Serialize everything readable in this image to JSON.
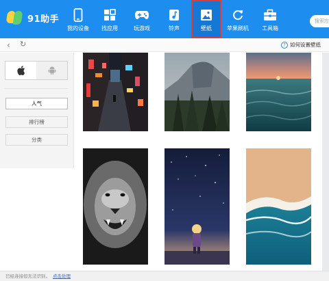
{
  "app": {
    "name": "91助手"
  },
  "nav": {
    "items": [
      {
        "label": "我的设备",
        "icon": "phone-icon"
      },
      {
        "label": "找应用",
        "icon": "apps-grid-icon"
      },
      {
        "label": "玩游戏",
        "icon": "gamepad-icon"
      },
      {
        "label": "铃声",
        "icon": "music-note-icon"
      },
      {
        "label": "壁纸",
        "icon": "image-icon",
        "active": true
      },
      {
        "label": "苹果刷机",
        "icon": "refresh-icon"
      },
      {
        "label": "工具箱",
        "icon": "toolbox-icon"
      }
    ],
    "search_placeholder": "搜索应"
  },
  "toolbar": {
    "back_icon": "chevron-left-icon",
    "refresh_icon": "refresh-icon",
    "help_text": "如何设置壁纸"
  },
  "sidebar": {
    "os": [
      {
        "icon": "apple-icon",
        "selected": true
      },
      {
        "icon": "android-icon",
        "selected": false
      }
    ],
    "categories": [
      {
        "label": "人气",
        "active": true
      },
      {
        "label": "排行榜"
      },
      {
        "label": "分类"
      }
    ]
  },
  "wallpapers": [
    {
      "name": "neon-alley"
    },
    {
      "name": "half-dome-mountain"
    },
    {
      "name": "ocean-sunset"
    },
    {
      "name": "lion-bw"
    },
    {
      "name": "starry-night-girl"
    },
    {
      "name": "beach-aerial"
    }
  ],
  "status": {
    "text": "已经连接但无法识别，",
    "link": "点击处理"
  },
  "colors": {
    "topbar": "#1d8df0",
    "active_nav_border": "#e03b3b"
  }
}
